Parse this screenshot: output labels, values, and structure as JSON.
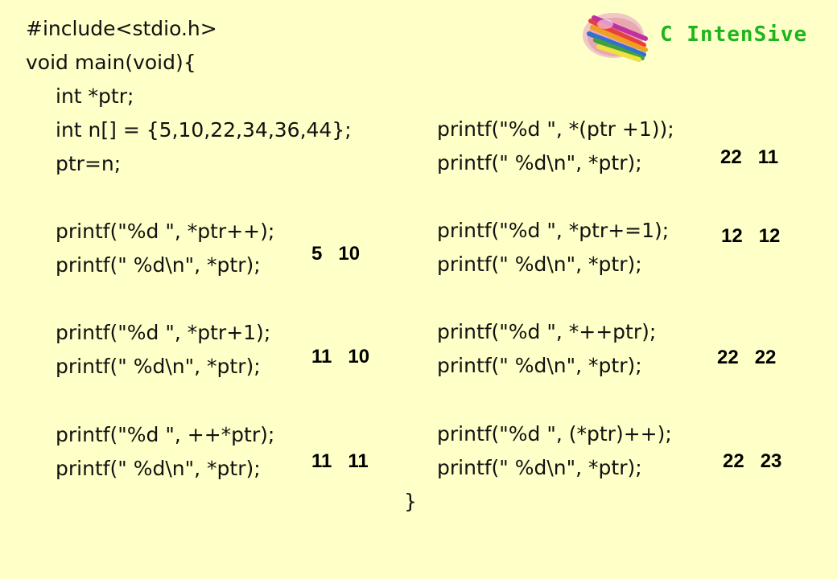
{
  "logo": {
    "text": "C IntenSive",
    "text_color": "#1db51d",
    "icon": "colored-pencils-icon"
  },
  "left_code": {
    "l1": "#include<stdio.h>",
    "l2": "void main(void){",
    "l3": "int *ptr;",
    "l4": "int n[] = {5,10,22,34,36,44};",
    "l5": "ptr=n;",
    "l6": "printf(\"%d \", *ptr++);",
    "l7": "printf(\" %d\\n\", *ptr);",
    "l8": "printf(\"%d \", *ptr+1);",
    "l9": "printf(\" %d\\n\", *ptr);",
    "l10": "printf(\"%d \", ++*ptr);",
    "l11": "printf(\" %d\\n\", *ptr);"
  },
  "right_code": {
    "r1": "printf(\"%d \", *(ptr +1));",
    "r2": "printf(\" %d\\n\", *ptr);",
    "r3": "printf(\"%d \", *ptr+=1);",
    "r4": "printf(\" %d\\n\", *ptr);",
    "r5": "printf(\"%d \", *++ptr);",
    "r6": "printf(\" %d\\n\", *ptr);",
    "r7": "printf(\"%d \", (*ptr)++);",
    "r8": "printf(\" %d\\n\", *ptr);",
    "close": "}"
  },
  "outputs": {
    "o1": "5   10",
    "o2": "11   10",
    "o3": "11   11",
    "o4": "22   11",
    "o5": "12   12",
    "o6": "22   22",
    "o7": "22   23"
  }
}
